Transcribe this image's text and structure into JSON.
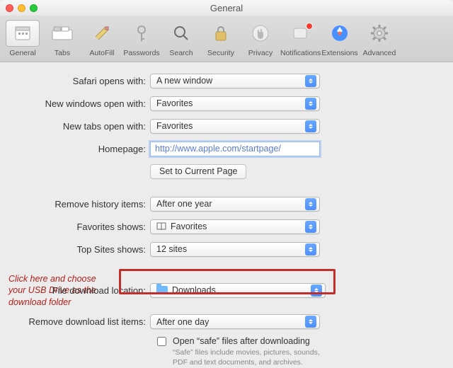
{
  "title": "General",
  "traffic": {
    "close": "close",
    "min": "minimize",
    "zoom": "zoom"
  },
  "toolbar": [
    {
      "id": "general",
      "label": "General"
    },
    {
      "id": "tabs",
      "label": "Tabs"
    },
    {
      "id": "autofill",
      "label": "AutoFill"
    },
    {
      "id": "passwords",
      "label": "Passwords"
    },
    {
      "id": "search",
      "label": "Search"
    },
    {
      "id": "security",
      "label": "Security"
    },
    {
      "id": "privacy",
      "label": "Privacy"
    },
    {
      "id": "notifications",
      "label": "Notifications"
    },
    {
      "id": "extensions",
      "label": "Extensions"
    },
    {
      "id": "advanced",
      "label": "Advanced"
    }
  ],
  "labels": {
    "safari_opens_with": "Safari opens with:",
    "new_windows": "New windows open with:",
    "new_tabs": "New tabs open with:",
    "homepage": "Homepage:",
    "set_current": "Set to Current Page",
    "remove_history": "Remove history items:",
    "favorites_shows": "Favorites shows:",
    "top_sites_shows": "Top Sites shows:",
    "file_download": "File download location:",
    "remove_downloads": "Remove download list items:",
    "open_safe": "Open “safe” files after downloading",
    "open_safe_sub": "“Safe” files include movies, pictures, sounds, PDF and text documents, and archives."
  },
  "values": {
    "safari_opens_with": "A new window",
    "new_windows": "Favorites",
    "new_tabs": "Favorites",
    "homepage": "http://www.apple.com/startpage/",
    "remove_history": "After one year",
    "favorites_shows": "Favorites",
    "top_sites_shows": "12 sites",
    "file_download": "Downloads",
    "remove_downloads": "After one day"
  },
  "annotation": "Click here and choose your USB Drive as the download folder"
}
